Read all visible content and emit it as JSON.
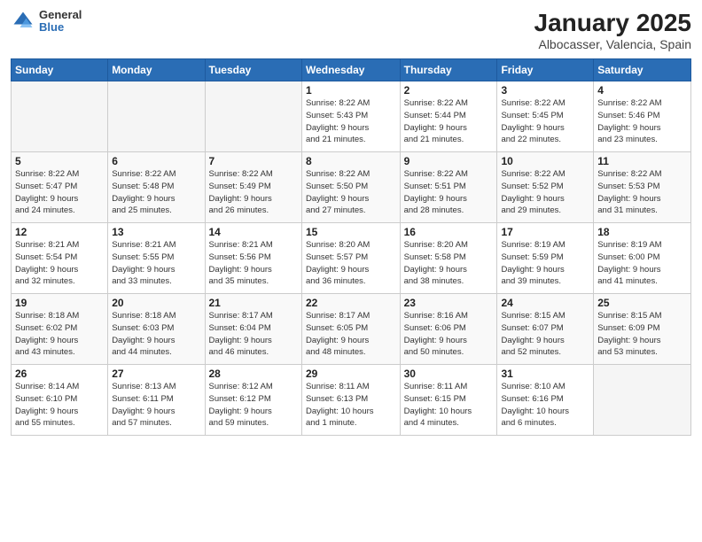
{
  "logo": {
    "general": "General",
    "blue": "Blue"
  },
  "title": "January 2025",
  "subtitle": "Albocasser, Valencia, Spain",
  "days_header": [
    "Sunday",
    "Monday",
    "Tuesday",
    "Wednesday",
    "Thursday",
    "Friday",
    "Saturday"
  ],
  "weeks": [
    [
      {
        "num": "",
        "info": ""
      },
      {
        "num": "",
        "info": ""
      },
      {
        "num": "",
        "info": ""
      },
      {
        "num": "1",
        "info": "Sunrise: 8:22 AM\nSunset: 5:43 PM\nDaylight: 9 hours\nand 21 minutes."
      },
      {
        "num": "2",
        "info": "Sunrise: 8:22 AM\nSunset: 5:44 PM\nDaylight: 9 hours\nand 21 minutes."
      },
      {
        "num": "3",
        "info": "Sunrise: 8:22 AM\nSunset: 5:45 PM\nDaylight: 9 hours\nand 22 minutes."
      },
      {
        "num": "4",
        "info": "Sunrise: 8:22 AM\nSunset: 5:46 PM\nDaylight: 9 hours\nand 23 minutes."
      }
    ],
    [
      {
        "num": "5",
        "info": "Sunrise: 8:22 AM\nSunset: 5:47 PM\nDaylight: 9 hours\nand 24 minutes."
      },
      {
        "num": "6",
        "info": "Sunrise: 8:22 AM\nSunset: 5:48 PM\nDaylight: 9 hours\nand 25 minutes."
      },
      {
        "num": "7",
        "info": "Sunrise: 8:22 AM\nSunset: 5:49 PM\nDaylight: 9 hours\nand 26 minutes."
      },
      {
        "num": "8",
        "info": "Sunrise: 8:22 AM\nSunset: 5:50 PM\nDaylight: 9 hours\nand 27 minutes."
      },
      {
        "num": "9",
        "info": "Sunrise: 8:22 AM\nSunset: 5:51 PM\nDaylight: 9 hours\nand 28 minutes."
      },
      {
        "num": "10",
        "info": "Sunrise: 8:22 AM\nSunset: 5:52 PM\nDaylight: 9 hours\nand 29 minutes."
      },
      {
        "num": "11",
        "info": "Sunrise: 8:22 AM\nSunset: 5:53 PM\nDaylight: 9 hours\nand 31 minutes."
      }
    ],
    [
      {
        "num": "12",
        "info": "Sunrise: 8:21 AM\nSunset: 5:54 PM\nDaylight: 9 hours\nand 32 minutes."
      },
      {
        "num": "13",
        "info": "Sunrise: 8:21 AM\nSunset: 5:55 PM\nDaylight: 9 hours\nand 33 minutes."
      },
      {
        "num": "14",
        "info": "Sunrise: 8:21 AM\nSunset: 5:56 PM\nDaylight: 9 hours\nand 35 minutes."
      },
      {
        "num": "15",
        "info": "Sunrise: 8:20 AM\nSunset: 5:57 PM\nDaylight: 9 hours\nand 36 minutes."
      },
      {
        "num": "16",
        "info": "Sunrise: 8:20 AM\nSunset: 5:58 PM\nDaylight: 9 hours\nand 38 minutes."
      },
      {
        "num": "17",
        "info": "Sunrise: 8:19 AM\nSunset: 5:59 PM\nDaylight: 9 hours\nand 39 minutes."
      },
      {
        "num": "18",
        "info": "Sunrise: 8:19 AM\nSunset: 6:00 PM\nDaylight: 9 hours\nand 41 minutes."
      }
    ],
    [
      {
        "num": "19",
        "info": "Sunrise: 8:18 AM\nSunset: 6:02 PM\nDaylight: 9 hours\nand 43 minutes."
      },
      {
        "num": "20",
        "info": "Sunrise: 8:18 AM\nSunset: 6:03 PM\nDaylight: 9 hours\nand 44 minutes."
      },
      {
        "num": "21",
        "info": "Sunrise: 8:17 AM\nSunset: 6:04 PM\nDaylight: 9 hours\nand 46 minutes."
      },
      {
        "num": "22",
        "info": "Sunrise: 8:17 AM\nSunset: 6:05 PM\nDaylight: 9 hours\nand 48 minutes."
      },
      {
        "num": "23",
        "info": "Sunrise: 8:16 AM\nSunset: 6:06 PM\nDaylight: 9 hours\nand 50 minutes."
      },
      {
        "num": "24",
        "info": "Sunrise: 8:15 AM\nSunset: 6:07 PM\nDaylight: 9 hours\nand 52 minutes."
      },
      {
        "num": "25",
        "info": "Sunrise: 8:15 AM\nSunset: 6:09 PM\nDaylight: 9 hours\nand 53 minutes."
      }
    ],
    [
      {
        "num": "26",
        "info": "Sunrise: 8:14 AM\nSunset: 6:10 PM\nDaylight: 9 hours\nand 55 minutes."
      },
      {
        "num": "27",
        "info": "Sunrise: 8:13 AM\nSunset: 6:11 PM\nDaylight: 9 hours\nand 57 minutes."
      },
      {
        "num": "28",
        "info": "Sunrise: 8:12 AM\nSunset: 6:12 PM\nDaylight: 9 hours\nand 59 minutes."
      },
      {
        "num": "29",
        "info": "Sunrise: 8:11 AM\nSunset: 6:13 PM\nDaylight: 10 hours\nand 1 minute."
      },
      {
        "num": "30",
        "info": "Sunrise: 8:11 AM\nSunset: 6:15 PM\nDaylight: 10 hours\nand 4 minutes."
      },
      {
        "num": "31",
        "info": "Sunrise: 8:10 AM\nSunset: 6:16 PM\nDaylight: 10 hours\nand 6 minutes."
      },
      {
        "num": "",
        "info": ""
      }
    ]
  ]
}
